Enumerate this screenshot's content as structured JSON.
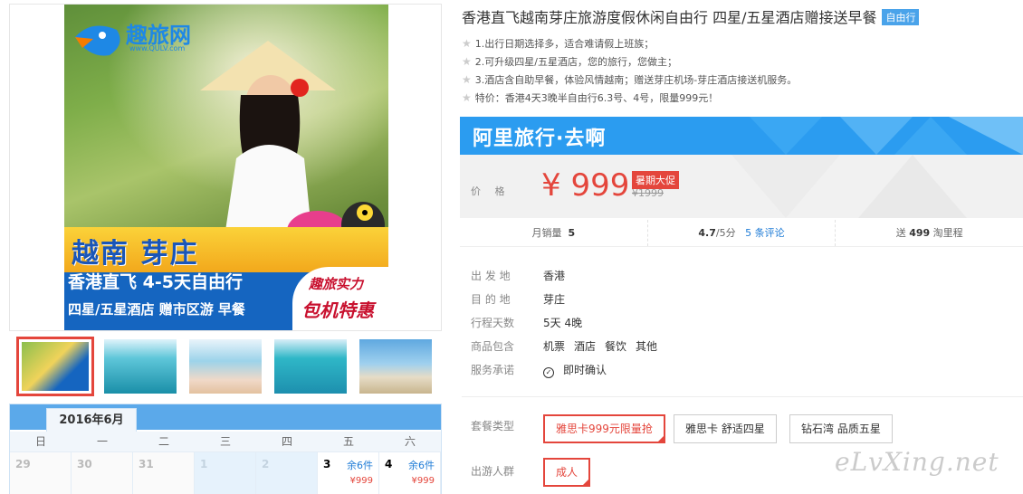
{
  "product": {
    "title": "香港直飞越南芽庄旅游度假休闲自由行 四星/五星酒店赠接送早餐",
    "tag": "自由行",
    "features": [
      "1.出行日期选择多，适合难请假上班族；",
      "2.可升级四星/五星酒店，您的旅行，您做主；",
      "3.酒店含自助早餐，体验风情越南；赠送芽庄机场-芽庄酒店接送机服务。",
      "特价：香港4天3晚半自由行6.3号、4号，限量999元！"
    ]
  },
  "poster": {
    "logo": "趣旅网",
    "logo_url": "www.QULV.com",
    "headline": "越南 芽庄",
    "subline": "香港直飞 4-5天自由行",
    "line3": "四星/五星酒店 赠市区游 早餐",
    "promo1": "趣旅实力",
    "promo2": "包机特惠"
  },
  "thumbnails": [
    "thumb-1",
    "thumb-2",
    "thumb-3",
    "thumb-4",
    "thumb-5"
  ],
  "calendar": {
    "month": "2016年6月",
    "weekdays": [
      "日",
      "一",
      "二",
      "三",
      "四",
      "五",
      "六"
    ],
    "days": [
      {
        "num": "29",
        "left": "",
        "price": ""
      },
      {
        "num": "30",
        "left": "",
        "price": ""
      },
      {
        "num": "31",
        "left": "",
        "price": ""
      },
      {
        "num": "1",
        "left": "",
        "price": ""
      },
      {
        "num": "2",
        "left": "",
        "price": ""
      },
      {
        "num": "3",
        "left": "余6件",
        "price": "¥999"
      },
      {
        "num": "4",
        "left": "余6件",
        "price": "¥999"
      }
    ]
  },
  "banner": {
    "text": "阿里旅行·去啊"
  },
  "price": {
    "label": "价 格",
    "value": "¥ 999",
    "promo": "暑期大促",
    "original": "¥1999"
  },
  "stats": {
    "sales_label": "月销量",
    "sales_value": "5",
    "rating": "4.7",
    "rating_suffix": "/5分",
    "reviews": "5 条评论",
    "points_prefix": "送",
    "points_value": "499",
    "points_suffix": "淘里程"
  },
  "info": [
    {
      "key": "出 发 地",
      "value": "香港"
    },
    {
      "key": "目 的 地",
      "value": "芽庄"
    },
    {
      "key": "行程天数",
      "value": "5天 4晚"
    }
  ],
  "includes": {
    "key": "商品包含",
    "items": [
      "机票",
      "酒店",
      "餐饮",
      "其他"
    ]
  },
  "promise": {
    "key": "服务承诺",
    "value": "即时确认"
  },
  "package": {
    "label": "套餐类型",
    "options": [
      "雅思卡999元限量抢",
      "雅思卡 舒适四星",
      "钻石湾 品质五星"
    ]
  },
  "travelers": {
    "label": "出游人群",
    "options": [
      "成人"
    ]
  },
  "watermark": "eLvXing.net",
  "colors": {
    "accent_red": "#e4463c",
    "banner_blue": "#2b9cf0",
    "link_blue": "#1e7bd6"
  }
}
